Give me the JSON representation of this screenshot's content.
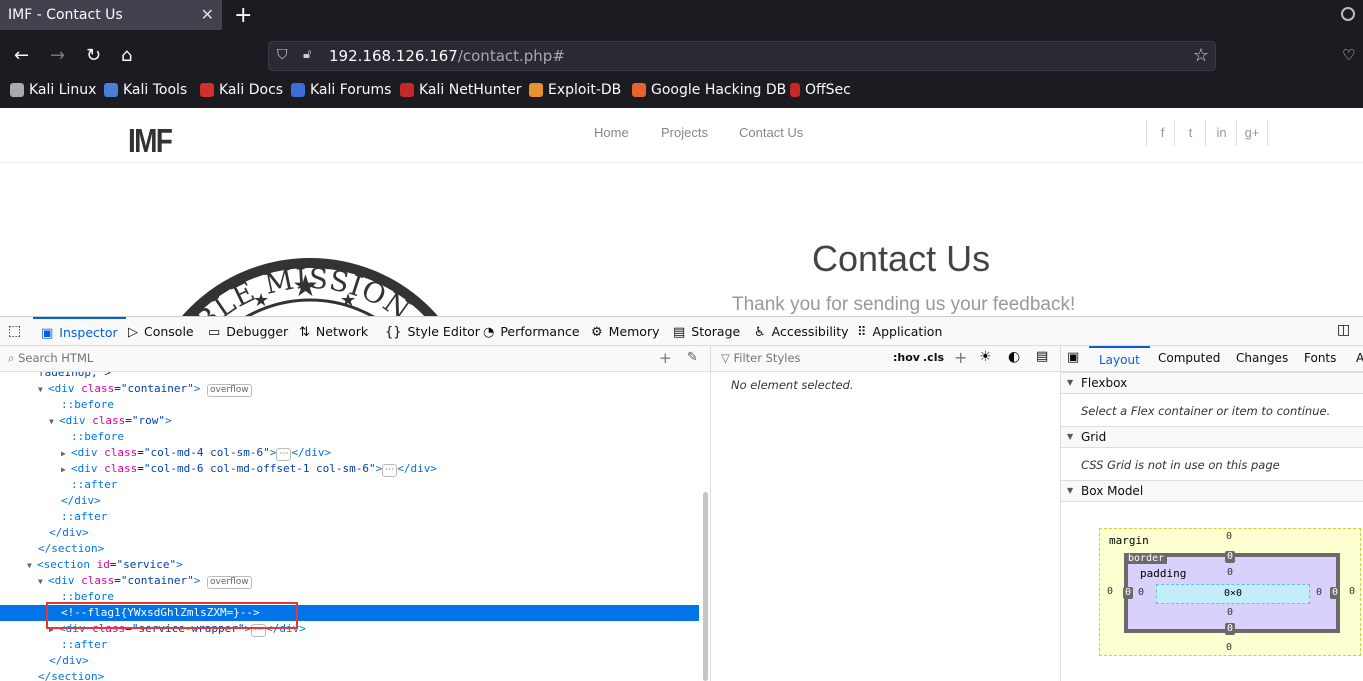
{
  "browser": {
    "tab_title": "IMF - Contact Us",
    "tab_close": "✕",
    "new_tab": "+",
    "url_host": "192.168.126.167",
    "url_path": "/contact.php#",
    "bookmarks": [
      "Kali Linux",
      "Kali Tools",
      "Kali Docs",
      "Kali Forums",
      "Kali NetHunter",
      "Exploit-DB",
      "Google Hacking DB",
      "OffSec"
    ]
  },
  "site": {
    "logo": "IMF",
    "nav": [
      "Home",
      "Projects",
      "Contact Us"
    ],
    "social": [
      "f",
      "t",
      "in",
      "g+"
    ],
    "emblem_text": "POSSIBLE MISSION FOR",
    "headline": "Contact Us",
    "thanks": "Thank you for sending us your feedback!"
  },
  "devtools": {
    "tabs": [
      "Inspector",
      "Console",
      "Debugger",
      "Network",
      "Style Editor",
      "Performance",
      "Memory",
      "Storage",
      "Accessibility",
      "Application"
    ],
    "search_placeholder": "Search HTML",
    "filter_placeholder": "Filter Styles",
    "hov": ":hov",
    "cls": ".cls",
    "no_selection": "No element selected.",
    "layout_tabs": [
      "Layout",
      "Computed",
      "Changes",
      "Fonts",
      "A"
    ],
    "flexbox_title": "Flexbox",
    "flexbox_note": "Select a Flex container or item to continue.",
    "grid_title": "Grid",
    "grid_note": "CSS Grid is not in use on this page",
    "boxmodel_title": "Box Model",
    "boxmodel": {
      "margin": "margin",
      "border": "border",
      "padding": "padding",
      "content": "0×0",
      "zero": "0"
    },
    "badge_overflow": "overflow",
    "flag_comment": "<!--flag1{YWxsdGhlZmlsZXM=}-->"
  }
}
